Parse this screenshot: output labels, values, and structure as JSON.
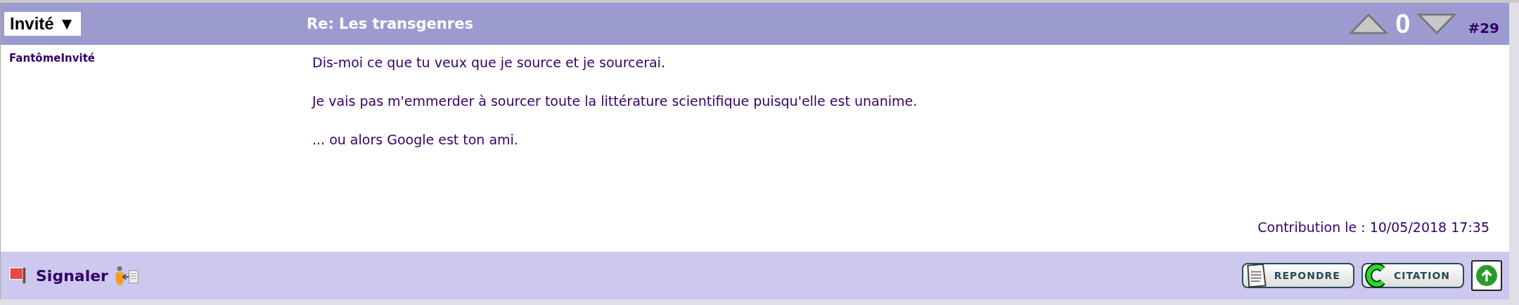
{
  "header": {
    "user_menu": "Invité ▼",
    "title": "Re: Les transgenres",
    "score": "0",
    "post_number": "#29"
  },
  "post": {
    "author": "FantômeInvité",
    "paragraphs": [
      "Dis-moi ce que tu veux que je source et je sourcerai.",
      "Je vais pas m'emmerder à sourcer toute la littérature scientifique puisqu'elle est unanime.",
      "... ou alors Google est ton ami."
    ],
    "date": "Contribution le : 10/05/2018 17:35"
  },
  "footer": {
    "report": "Signaler",
    "buttons": [
      {
        "kind": "reply",
        "label": "REPONDRE"
      },
      {
        "kind": "quote",
        "label": "CITATION"
      },
      {
        "kind": "top"
      }
    ]
  }
}
